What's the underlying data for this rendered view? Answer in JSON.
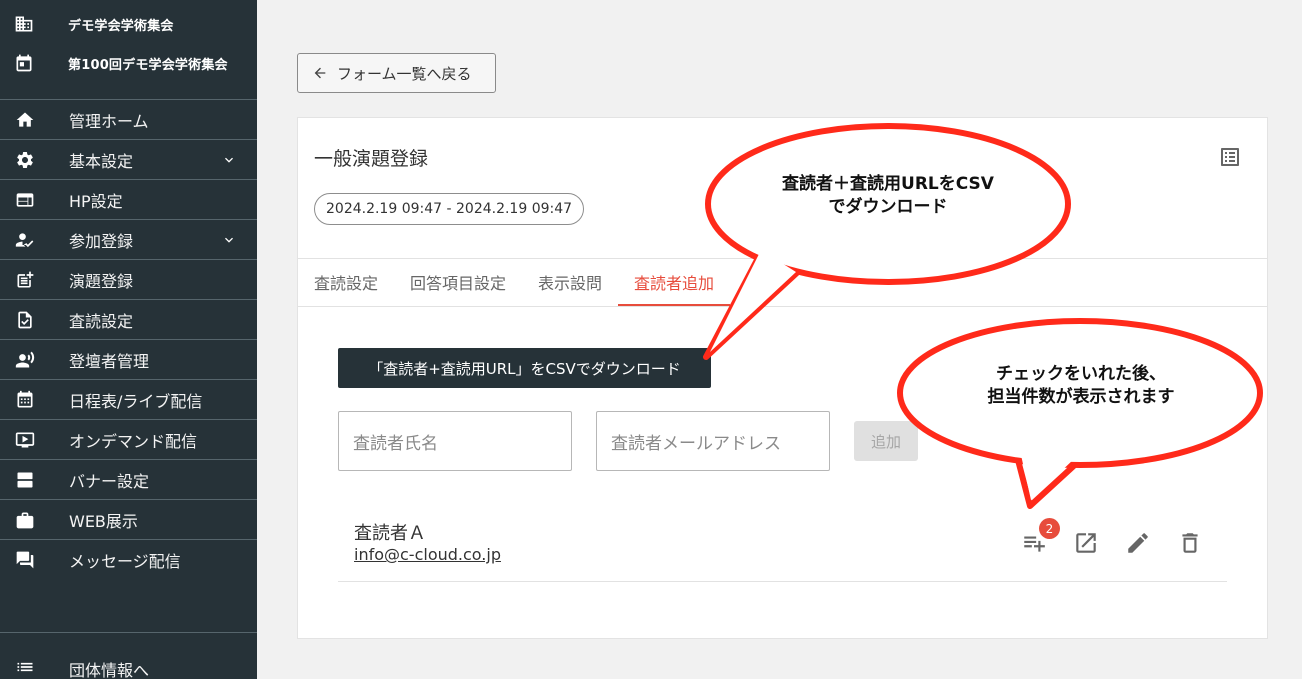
{
  "sidebar": {
    "org_name": "デモ学会学術集会",
    "event_name": "第100回デモ学会学術集会",
    "items": [
      {
        "label": "管理ホーム",
        "icon": "home-icon"
      },
      {
        "label": "基本設定",
        "icon": "gear-icon"
      },
      {
        "label": "HP設定",
        "icon": "web-icon"
      },
      {
        "label": "参加登録",
        "icon": "person-check-icon"
      },
      {
        "label": "演題登録",
        "icon": "post-add-icon"
      },
      {
        "label": "査読設定",
        "icon": "document-check-icon"
      },
      {
        "label": "登壇者管理",
        "icon": "people-icon"
      },
      {
        "label": "日程表/ライブ配信",
        "icon": "calendar-icon"
      },
      {
        "label": "オンデマンド配信",
        "icon": "video-icon"
      },
      {
        "label": "バナー設定",
        "icon": "banner-icon"
      },
      {
        "label": "WEB展示",
        "icon": "briefcase-icon"
      },
      {
        "label": "メッセージ配信",
        "icon": "chat-icon"
      }
    ],
    "footer_label": "団体情報へ"
  },
  "main": {
    "back_label": "フォーム一覧へ戻る",
    "form_title": "一般演題登録",
    "date_range": "2024.2.19 09:47 - 2024.2.19 09:47",
    "tabs": [
      {
        "label": "査読設定",
        "active": false
      },
      {
        "label": "回答項目設定",
        "active": false
      },
      {
        "label": "表示設問",
        "active": false
      },
      {
        "label": "査読者追加",
        "active": true
      }
    ],
    "csv_button_label": "「査読者+査読用URL」をCSVでダウンロード",
    "name_placeholder": "査読者氏名",
    "email_placeholder": "査読者メールアドレス",
    "add_label": "追加",
    "reviewer": {
      "name": "査読者Ａ",
      "email": "info@c-cloud.co.jp",
      "assigned_count": "2"
    }
  },
  "callouts": {
    "csv_line1": "査読者＋査読用URLをCSV",
    "csv_line2": "でダウンロード",
    "count_line1": "チェックをいれた後、",
    "count_line2": "担当件数が表示されます"
  },
  "colors": {
    "sidebar_bg": "#263238",
    "accent": "#e74c3c",
    "callout_red": "#ff2a1a"
  }
}
